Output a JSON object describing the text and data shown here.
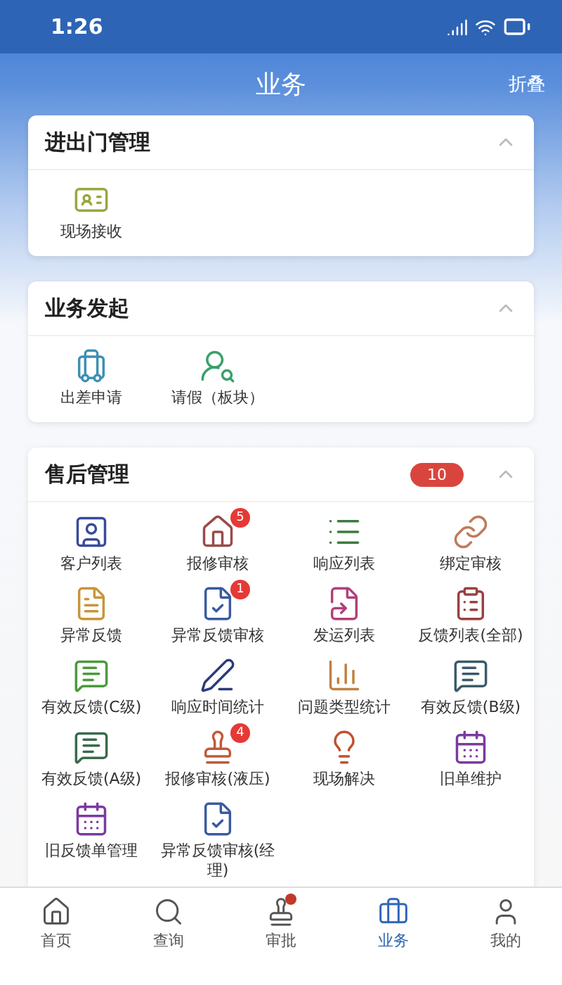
{
  "status_bar": {
    "time": "1:26"
  },
  "header": {
    "title": "业务",
    "action": "折叠"
  },
  "sections": [
    {
      "title": "进出门管理",
      "expanded": true,
      "items": [
        {
          "label": "现场接收"
        }
      ]
    },
    {
      "title": "业务发起",
      "expanded": true,
      "items": [
        {
          "label": "出差申请"
        },
        {
          "label": "请假（板块）"
        }
      ]
    },
    {
      "title": "售后管理",
      "expanded": true,
      "badge": "10",
      "items": [
        {
          "label": "客户列表"
        },
        {
          "label": "报修审核",
          "badge": "5"
        },
        {
          "label": "响应列表"
        },
        {
          "label": "绑定审核"
        },
        {
          "label": "异常反馈"
        },
        {
          "label": "异常反馈审核",
          "badge": "1"
        },
        {
          "label": "发运列表"
        },
        {
          "label": "反馈列表(全部)"
        },
        {
          "label": "有效反馈(C级)"
        },
        {
          "label": "响应时间统计"
        },
        {
          "label": "问题类型统计"
        },
        {
          "label": "有效反馈(B级)"
        },
        {
          "label": "有效反馈(A级)"
        },
        {
          "label": "报修审核(液压)",
          "badge": "4"
        },
        {
          "label": "现场解决"
        },
        {
          "label": "旧单维护"
        },
        {
          "label": "旧反馈单管理"
        },
        {
          "label": "异常反馈审核(经理)"
        }
      ]
    }
  ],
  "tab_bar": [
    {
      "label": "首页",
      "selected": false,
      "dot": false
    },
    {
      "label": "查询",
      "selected": false,
      "dot": false
    },
    {
      "label": "审批",
      "selected": false,
      "dot": true
    },
    {
      "label": "业务",
      "selected": true,
      "dot": false
    },
    {
      "label": "我的",
      "selected": false,
      "dot": false
    }
  ]
}
